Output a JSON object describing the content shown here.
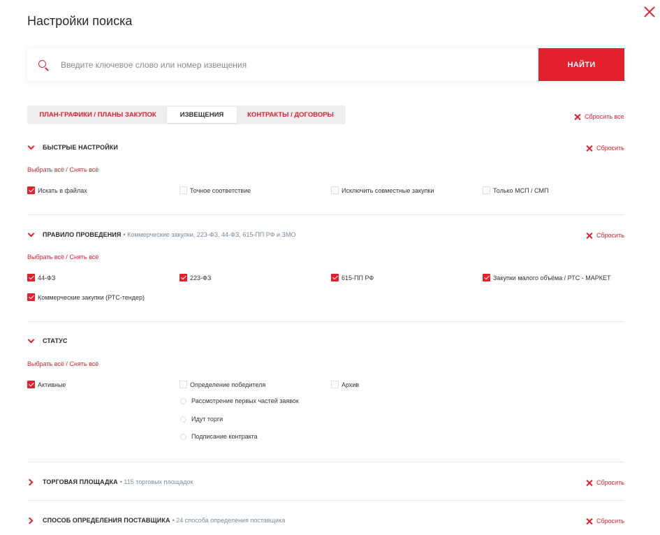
{
  "modal": {
    "title": "Настройки поиска"
  },
  "search": {
    "placeholder": "Введите ключевое слово или номер извещения",
    "value": "",
    "button_label": "НАЙТИ"
  },
  "tabs": [
    {
      "label": "ПЛАН-ГРАФИКИ / ПЛАНЫ ЗАКУПОК",
      "active": false
    },
    {
      "label": "ИЗВЕЩЕНИЯ",
      "active": true
    },
    {
      "label": "КОНТРАКТЫ / ДОГОВОРЫ",
      "active": false
    }
  ],
  "reset_all_label": "Сбросить все",
  "reset_label": "Сбросить",
  "select_all_label": "Выбрать всё / Снять всё",
  "sections": {
    "quick": {
      "title": "БЫСТРЫЕ НАСТРОЙКИ",
      "options": [
        {
          "label": "Искать в файлах",
          "checked": true
        },
        {
          "label": "Точное соответствие",
          "checked": false
        },
        {
          "label": "Исключить совместные закупки",
          "checked": false
        },
        {
          "label": "Только МСП / СМП",
          "checked": false
        }
      ]
    },
    "rule": {
      "title": "ПРАВИЛО ПРОВЕДЕНИЯ",
      "subtitle": "• Коммерческие закупки, 223-ФЗ, 44-ФЗ, 615-ПП РФ и ЗМО",
      "options": [
        {
          "label": "44-ФЗ",
          "checked": true
        },
        {
          "label": "223-ФЗ",
          "checked": true
        },
        {
          "label": "615-ПП РФ",
          "checked": true
        },
        {
          "label": "Закупки малого объёма / РТС - МАРКЕТ",
          "checked": true
        },
        {
          "label": "Коммерческие закупки (РТС-тендер)",
          "checked": true
        }
      ]
    },
    "status": {
      "title": "СТАТУС",
      "options": [
        {
          "label": "Активные",
          "checked": true
        },
        {
          "label": "Определение победителя",
          "checked": false
        },
        {
          "label": "Архив",
          "checked": false
        }
      ],
      "sub_options": [
        {
          "label": "Рассмотрение первых частей заявок",
          "selected": false
        },
        {
          "label": "Идут торги",
          "selected": false
        },
        {
          "label": "Подписание контракта",
          "selected": false
        }
      ]
    },
    "platform": {
      "title": "ТОРГОВАЯ ПЛОЩАДКА",
      "subtitle": "• 115 торговых площадок"
    },
    "method": {
      "title": "СПОСОБ ОПРЕДЕЛЕНИЯ ПОСТАВЩИКА",
      "subtitle": "• 24 способа определения поставщика"
    }
  },
  "colors": {
    "accent": "#e3202e",
    "tab_bg": "#eeeeee",
    "divider": "#e6e6e6"
  }
}
